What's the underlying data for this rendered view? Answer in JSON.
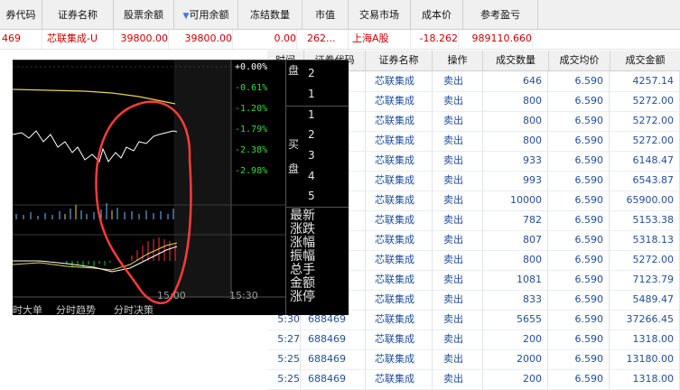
{
  "holdings": {
    "headers": [
      "券代码",
      "证券名称",
      "股票余额",
      "可用余额",
      "冻结数量",
      "市值",
      "交易市场",
      "成本价",
      "参考盈亏"
    ],
    "sort_indicator": "▼",
    "row": [
      "469",
      "芯联集成-U",
      "39800.00",
      "39800.00",
      "0.00",
      "262...",
      "上海A股",
      "-18.262",
      "989110.660"
    ]
  },
  "trades": {
    "headers": [
      "时间",
      "证券代码",
      "证券名称",
      "操作",
      "成交数量",
      "成交均价",
      "成交金额"
    ],
    "rows": [
      {
        "time": "",
        "code": "",
        "name": "芯联集成",
        "op": "卖出",
        "qty": "646",
        "price": "6.590",
        "amount": "4257.14"
      },
      {
        "time": "",
        "code": "",
        "name": "芯联集成",
        "op": "卖出",
        "qty": "800",
        "price": "6.590",
        "amount": "5272.00"
      },
      {
        "time": "",
        "code": "",
        "name": "芯联集成",
        "op": "卖出",
        "qty": "800",
        "price": "6.590",
        "amount": "5272.00"
      },
      {
        "time": "",
        "code": "",
        "name": "芯联集成",
        "op": "卖出",
        "qty": "800",
        "price": "6.590",
        "amount": "5272.00"
      },
      {
        "time": "",
        "code": "",
        "name": "芯联集成",
        "op": "卖出",
        "qty": "933",
        "price": "6.590",
        "amount": "6148.47"
      },
      {
        "time": "",
        "code": "",
        "name": "芯联集成",
        "op": "卖出",
        "qty": "993",
        "price": "6.590",
        "amount": "6543.87"
      },
      {
        "time": "",
        "code": "",
        "name": "芯联集成",
        "op": "卖出",
        "qty": "10000",
        "price": "6.590",
        "amount": "65900.00"
      },
      {
        "time": "",
        "code": "",
        "name": "芯联集成",
        "op": "卖出",
        "qty": "782",
        "price": "6.590",
        "amount": "5153.38"
      },
      {
        "time": "",
        "code": "",
        "name": "芯联集成",
        "op": "卖出",
        "qty": "807",
        "price": "6.590",
        "amount": "5318.13"
      },
      {
        "time": "",
        "code": "",
        "name": "芯联集成",
        "op": "卖出",
        "qty": "800",
        "price": "6.590",
        "amount": "5272.00"
      },
      {
        "time": "",
        "code": "",
        "name": "芯联集成",
        "op": "卖出",
        "qty": "1081",
        "price": "6.590",
        "amount": "7123.79"
      },
      {
        "time": "",
        "code": "",
        "name": "芯联集成",
        "op": "卖出",
        "qty": "833",
        "price": "6.590",
        "amount": "5489.47"
      },
      {
        "time": "5:30",
        "code": "688469",
        "name": "芯联集成",
        "op": "卖出",
        "qty": "5655",
        "price": "6.590",
        "amount": "37266.45"
      },
      {
        "time": "5:27",
        "code": "688469",
        "name": "芯联集成",
        "op": "卖出",
        "qty": "200",
        "price": "6.590",
        "amount": "1318.00"
      },
      {
        "time": "5:25",
        "code": "688469",
        "name": "芯联集成",
        "op": "卖出",
        "qty": "2000",
        "price": "6.590",
        "amount": "13180.00"
      },
      {
        "time": "5:25",
        "code": "688469",
        "name": "芯联集成",
        "op": "卖出",
        "qty": "200",
        "price": "6.590",
        "amount": "1318.00"
      }
    ]
  },
  "chart": {
    "pct_labels": [
      "+0.00%",
      "-0.61%",
      "-1.20%",
      "-1.79%",
      "-2.38%",
      "-2.98%"
    ],
    "time_labels": [
      "15:00",
      "15:30"
    ],
    "bottom_tabs": [
      "时大单",
      "分时趋势",
      "分时决策"
    ],
    "colors": {
      "price_line": "#ffffff",
      "avg_line": "#e6d64a",
      "volume": "#6fc3ff",
      "volume_high": "#f0e030",
      "pct": "#33dd33",
      "up": "#ff3333",
      "down": "#00cc44",
      "annotation": "#ff3b3b"
    }
  },
  "orderbook": {
    "sell_label": "盘",
    "sell_levels": [
      "2",
      "1"
    ],
    "buy_label_1": "买",
    "buy_label_2": "盘",
    "buy_levels": [
      "1",
      "2",
      "3",
      "4",
      "5"
    ],
    "stats": [
      "最新",
      "涨跌",
      "涨幅",
      "振幅",
      "总手",
      "金额",
      "涨停"
    ]
  }
}
